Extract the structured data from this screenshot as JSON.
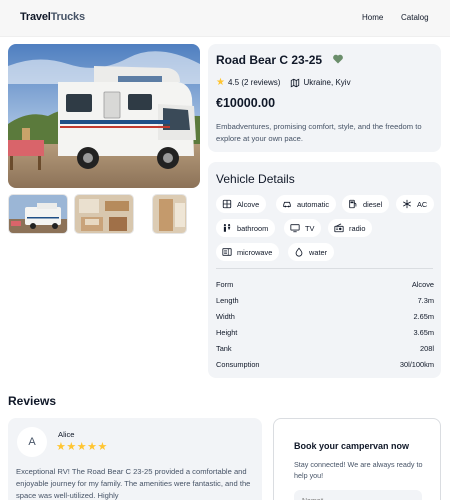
{
  "header": {
    "logo_main": "Travel",
    "logo_accent": "Trucks",
    "nav": [
      "Home",
      "Catalog"
    ]
  },
  "camper": {
    "name": "Road Bear C 23-25",
    "rating": "4.5 (2 reviews)",
    "location": "Ukraine, Kyiv",
    "price": "€10000.00",
    "description": "Embadventures, promising comfort, style, and the freedom to explore at your own pace."
  },
  "details": {
    "title": "Vehicle Details",
    "features": [
      {
        "label": "Alcove",
        "icon": "grid-icon"
      },
      {
        "label": "automatic",
        "icon": "automatic-icon"
      },
      {
        "label": "diesel",
        "icon": "fuel-pump-icon"
      },
      {
        "label": "AC",
        "icon": "snowflake-icon"
      },
      {
        "label": "bathroom",
        "icon": "shower-icon"
      },
      {
        "label": "TV",
        "icon": "tv-icon"
      },
      {
        "label": "radio",
        "icon": "radio-icon"
      },
      {
        "label": "microwave",
        "icon": "microwave-icon"
      },
      {
        "label": "water",
        "icon": "water-drop-icon"
      }
    ],
    "specs": [
      {
        "key": "Form",
        "value": "Alcove"
      },
      {
        "key": "Length",
        "value": "7.3m"
      },
      {
        "key": "Width",
        "value": "2.65m"
      },
      {
        "key": "Height",
        "value": "3.65m"
      },
      {
        "key": "Tank",
        "value": "208l"
      },
      {
        "key": "Consumption",
        "value": "30l/100km"
      }
    ]
  },
  "reviews": {
    "title": "Reviews",
    "items": [
      {
        "initial": "A",
        "name": "Alice",
        "stars": "★★★★★",
        "text": "Exceptional RV! The Road Bear C 23-25 provided a comfortable and enjoyable journey for my family. The amenities were fantastic, and the space was well-utilized. Highly"
      }
    ]
  },
  "booking": {
    "title": "Book your campervan now",
    "subtitle": "Stay connected! We are always ready to help you!",
    "name_placeholder": "Name*"
  },
  "colors": {
    "star": "#ffc531",
    "card_bg": "#f2f4f7",
    "heart": "#6b8e6b"
  }
}
